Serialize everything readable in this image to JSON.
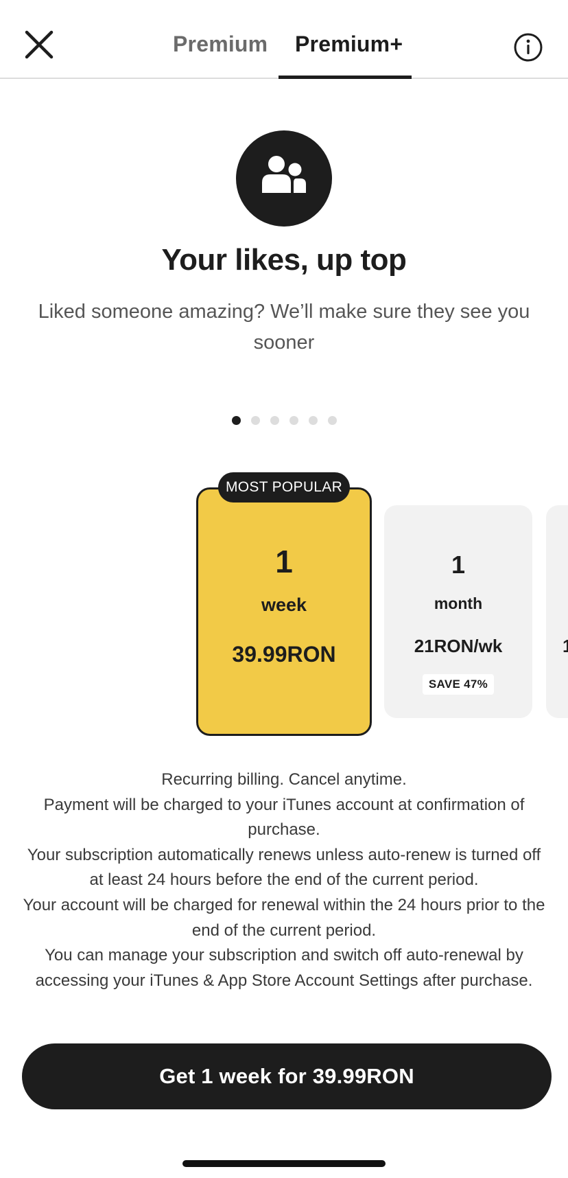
{
  "header": {
    "tabs": [
      {
        "label": "Premium",
        "selected": false
      },
      {
        "label": "Premium+",
        "selected": true
      }
    ],
    "close_icon": "close-icon",
    "info_icon": "info-icon"
  },
  "feature": {
    "icon": "people-icon",
    "title": "Your likes, up top",
    "description": "Liked someone amazing? We’ll make sure they see you sooner"
  },
  "carousel": {
    "pages": 6,
    "active_index": 0
  },
  "plans": {
    "selected": {
      "badge": "MOST POPULAR",
      "number": "1",
      "unit": "week",
      "price": "39.99RON"
    },
    "month": {
      "number": "1",
      "unit": "month",
      "price": "21RON/wk",
      "save": "SAVE 47%"
    },
    "third_partial": {
      "price": "1"
    }
  },
  "legal": {
    "lines": [
      "Recurring billing. Cancel anytime.",
      "Payment will be charged to your iTunes account at confirmation of purchase.",
      "Your subscription automatically renews unless auto-renew is turned off at least 24 hours before the end of the current period.",
      "Your account will be charged for renewal within the 24 hours prior to the end of the current period.",
      "You can manage your subscription and switch off auto-renewal by accessing your iTunes & App Store Account Settings after purchase."
    ]
  },
  "cta": {
    "label": "Get 1 week for 39.99RON"
  },
  "colors": {
    "accent": "#f2ca47",
    "dark": "#1d1d1d",
    "card": "#f2f2f2"
  }
}
